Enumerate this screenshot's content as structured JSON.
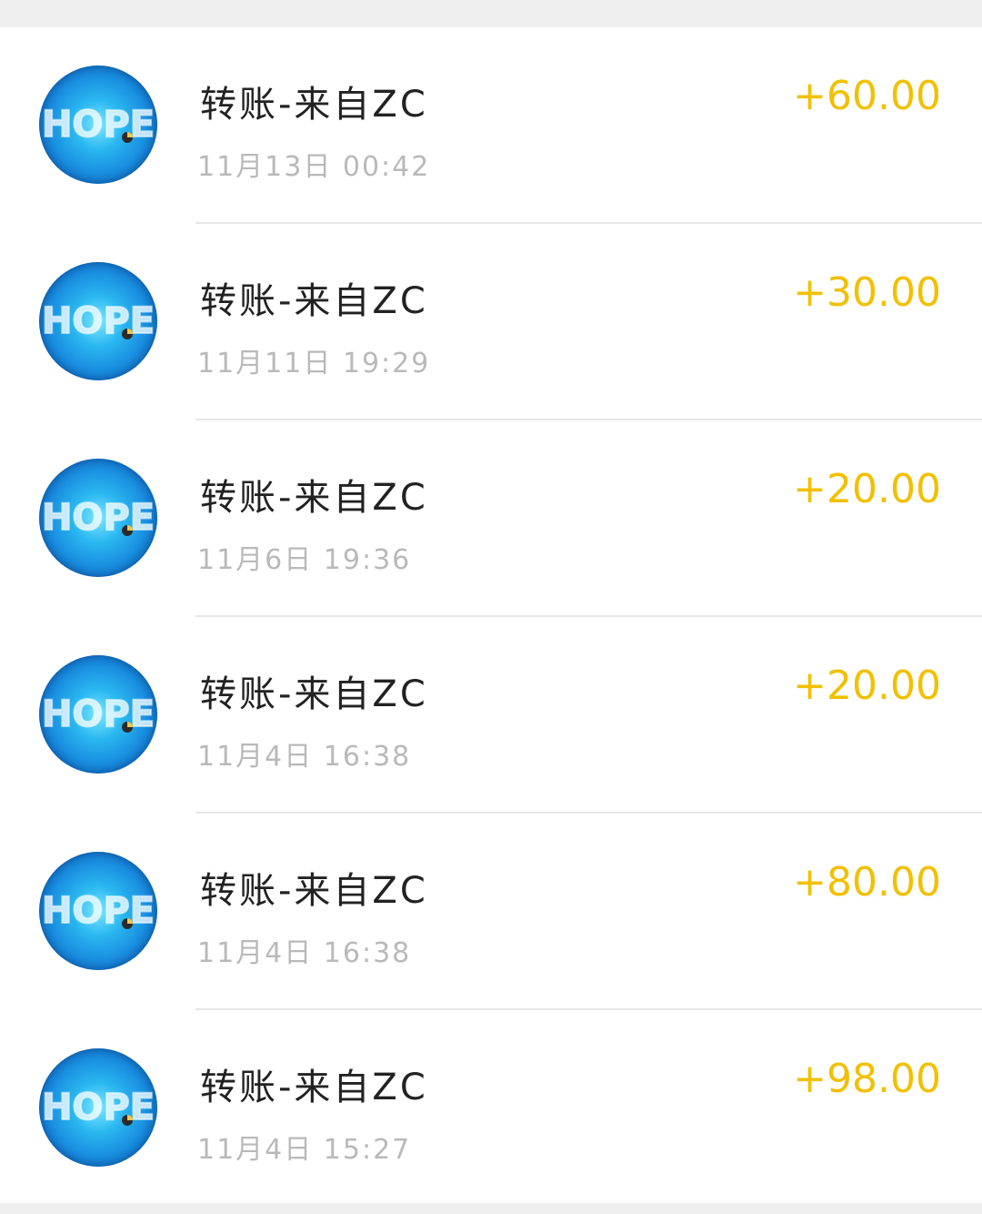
{
  "colors": {
    "page_background": "#efefef",
    "list_background": "#ffffff",
    "title_text": "#222222",
    "time_text": "#b9b9b9",
    "amount_text": "#f2c000",
    "divider": "#e7e7e7",
    "avatar_blue": "#1a8fe0"
  },
  "avatar": {
    "icon": "hope-logo-avatar",
    "logo_text": "HOPE"
  },
  "transactions": [
    {
      "title": "转账-来自ZC",
      "time": "11月13日 00:42",
      "amount": "+60.00"
    },
    {
      "title": "转账-来自ZC",
      "time": "11月11日 19:29",
      "amount": "+30.00"
    },
    {
      "title": "转账-来自ZC",
      "time": "11月6日 19:36",
      "amount": "+20.00"
    },
    {
      "title": "转账-来自ZC",
      "time": "11月4日 16:38",
      "amount": "+20.00"
    },
    {
      "title": "转账-来自ZC",
      "time": "11月4日 16:38",
      "amount": "+80.00"
    },
    {
      "title": "转账-来自ZC",
      "time": "11月4日 15:27",
      "amount": "+98.00"
    }
  ]
}
